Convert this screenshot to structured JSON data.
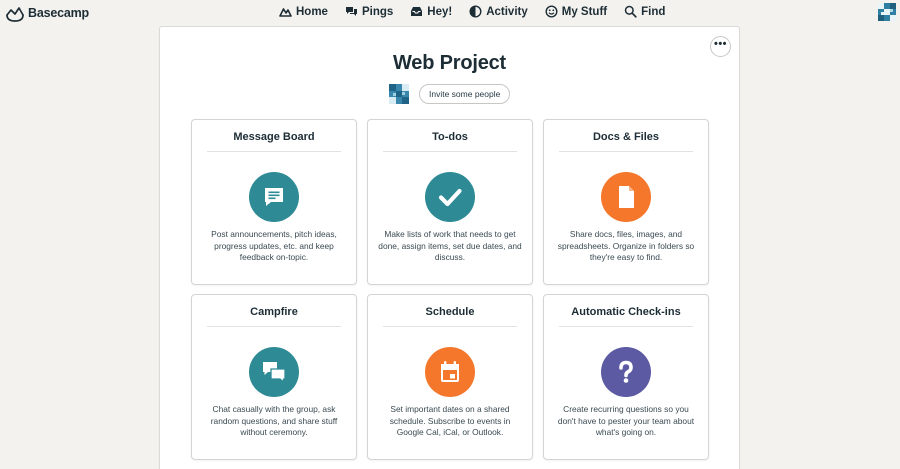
{
  "colors": {
    "teal": "#2e8b96",
    "orange": "#f5772b",
    "purple": "#5b5aa3",
    "text": "#1d2d35"
  },
  "app": {
    "name": "Basecamp",
    "logo_icon": "basecamp-logo-icon"
  },
  "nav": [
    {
      "label": "Home",
      "icon": "home-icon"
    },
    {
      "label": "Pings",
      "icon": "pings-icon"
    },
    {
      "label": "Hey!",
      "icon": "inbox-icon"
    },
    {
      "label": "Activity",
      "icon": "activity-icon"
    },
    {
      "label": "My Stuff",
      "icon": "smiley-icon"
    },
    {
      "label": "Find",
      "icon": "search-icon"
    }
  ],
  "project": {
    "title": "Web Project",
    "invite_label": "Invite some people",
    "options_label": "•••"
  },
  "tools": [
    {
      "title": "Message Board",
      "icon": "message-board-icon",
      "color": "#2e8b96",
      "description": "Post announcements, pitch ideas, progress updates, etc. and keep feedback on-topic."
    },
    {
      "title": "To-dos",
      "icon": "checkmark-icon",
      "color": "#2e8b96",
      "description": "Make lists of work that needs to get done, assign items, set due dates, and discuss."
    },
    {
      "title": "Docs & Files",
      "icon": "document-icon",
      "color": "#f5772b",
      "description": "Share docs, files, images, and spreadsheets. Organize in folders so they're easy to find."
    },
    {
      "title": "Campfire",
      "icon": "chat-bubbles-icon",
      "color": "#2e8b96",
      "description": "Chat casually with the group, ask random questions, and share stuff without ceremony."
    },
    {
      "title": "Schedule",
      "icon": "calendar-icon",
      "color": "#f5772b",
      "description": "Set important dates on a shared schedule. Subscribe to events in Google Cal, iCal, or Outlook."
    },
    {
      "title": "Automatic Check-ins",
      "icon": "question-mark-icon",
      "color": "#5b5aa3",
      "description": "Create recurring questions so you don't have to pester your team about what's going on."
    }
  ]
}
